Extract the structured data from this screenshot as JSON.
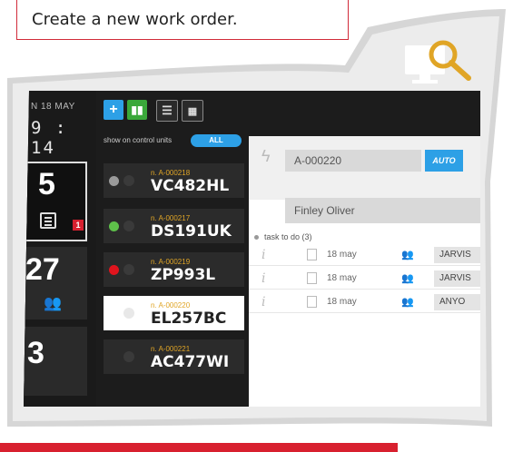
{
  "caption": "Create a new work order.",
  "colors": {
    "accent_red": "#d8202f",
    "brand_blue": "#2da0e6",
    "green": "#3aa83a",
    "orange": "#e0a526"
  },
  "app": {
    "date": "N 18 MAY",
    "time": "9 : 14",
    "toolbar": {
      "new_icon": "plus-icon",
      "stats_icon": "bar-chart-icon",
      "list_icon": "list-icon",
      "calendar_icon": "calendar-icon"
    },
    "filter_label": "show on control units",
    "filter_value": "ALL",
    "days": [
      {
        "num": "5",
        "badge": "1"
      },
      {
        "num": "27"
      },
      {
        "num": "3"
      }
    ],
    "units": [
      {
        "order": "n. A-000218",
        "plate": "VC482HL",
        "status": "gray"
      },
      {
        "order": "n. A-000217",
        "plate": "DS191UK",
        "status": "green"
      },
      {
        "order": "n. A-000219",
        "plate": "ZP993L",
        "status": "red"
      },
      {
        "order": "n. A-000220",
        "plate": "EL257BC",
        "status": "none"
      },
      {
        "order": "n. A-000221",
        "plate": "AC477WI",
        "status": "none"
      }
    ],
    "detail": {
      "order_number": "A-000220",
      "auto_label": "AUTO",
      "customer": "Finley Oliver",
      "task_header": "task to do (3)",
      "tasks": [
        {
          "date": "18 may",
          "assignee": "JARVIS"
        },
        {
          "date": "18 may",
          "assignee": "JARVIS"
        },
        {
          "date": "18 may",
          "assignee": "ANYO"
        }
      ]
    }
  }
}
